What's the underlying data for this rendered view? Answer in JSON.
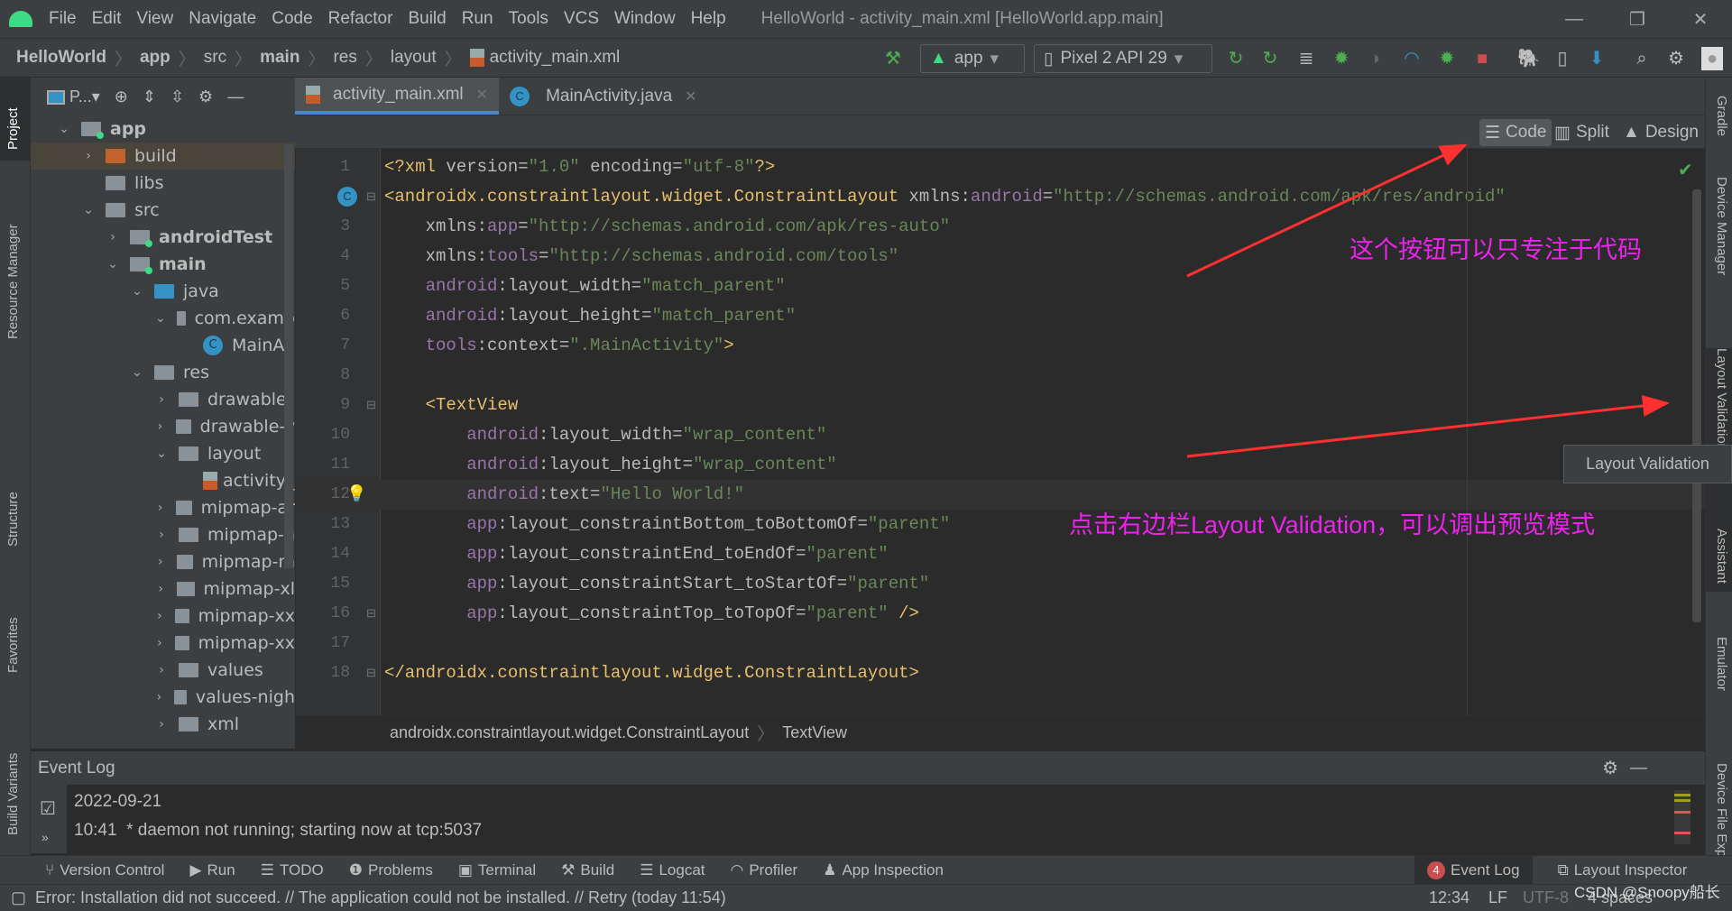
{
  "window": {
    "title": "HelloWorld - activity_main.xml [HelloWorld.app.main]",
    "menu": [
      "File",
      "Edit",
      "View",
      "Navigate",
      "Code",
      "Refactor",
      "Build",
      "Run",
      "Tools",
      "VCS",
      "Window",
      "Help"
    ]
  },
  "breadcrumb": [
    "HelloWorld",
    "app",
    "src",
    "main",
    "res",
    "layout",
    "activity_main.xml"
  ],
  "toolbar": {
    "run_config": "app",
    "device": "Pixel 2 API 29"
  },
  "left_strip": [
    "Project",
    "Resource Manager",
    "Structure",
    "Favorites",
    "Build Variants"
  ],
  "right_strip": [
    "Gradle",
    "Device Manager",
    "Layout Validation",
    "Assistant",
    "Emulator",
    "Device File Explorer"
  ],
  "project": {
    "view_label": "P...",
    "tree": [
      {
        "label": "app",
        "depth": 0,
        "open": "v",
        "icon": "module",
        "bold": true
      },
      {
        "label": "build",
        "depth": 1,
        "open": ">",
        "icon": "orange",
        "selected": true
      },
      {
        "label": "libs",
        "depth": 1,
        "open": "",
        "icon": "folder"
      },
      {
        "label": "src",
        "depth": 1,
        "open": "v",
        "icon": "folder"
      },
      {
        "label": "androidTest",
        "depth": 2,
        "open": ">",
        "icon": "module",
        "bold": true
      },
      {
        "label": "main",
        "depth": 2,
        "open": "v",
        "icon": "module",
        "bold": true
      },
      {
        "label": "java",
        "depth": 3,
        "open": "v",
        "icon": "blue"
      },
      {
        "label": "com.examp",
        "depth": 4,
        "open": "v",
        "icon": "package"
      },
      {
        "label": "MainAc",
        "depth": 5,
        "open": "",
        "icon": "class"
      },
      {
        "label": "res",
        "depth": 3,
        "open": "v",
        "icon": "res"
      },
      {
        "label": "drawable",
        "depth": 4,
        "open": ">",
        "icon": "folder"
      },
      {
        "label": "drawable-v",
        "depth": 4,
        "open": ">",
        "icon": "folder"
      },
      {
        "label": "layout",
        "depth": 4,
        "open": "v",
        "icon": "folder"
      },
      {
        "label": "activity_",
        "depth": 5,
        "open": "",
        "icon": "xml"
      },
      {
        "label": "mipmap-ar",
        "depth": 4,
        "open": ">",
        "icon": "folder"
      },
      {
        "label": "mipmap-h",
        "depth": 4,
        "open": ">",
        "icon": "folder"
      },
      {
        "label": "mipmap-m",
        "depth": 4,
        "open": ">",
        "icon": "folder"
      },
      {
        "label": "mipmap-xl",
        "depth": 4,
        "open": ">",
        "icon": "folder"
      },
      {
        "label": "mipmap-xx",
        "depth": 4,
        "open": ">",
        "icon": "folder"
      },
      {
        "label": "mipmap-xx",
        "depth": 4,
        "open": ">",
        "icon": "folder"
      },
      {
        "label": "values",
        "depth": 4,
        "open": ">",
        "icon": "folder"
      },
      {
        "label": "values-nigh",
        "depth": 4,
        "open": ">",
        "icon": "folder"
      },
      {
        "label": "xml",
        "depth": 4,
        "open": ">",
        "icon": "folder"
      }
    ]
  },
  "tabs": [
    {
      "label": "activity_main.xml",
      "active": true,
      "icon": "xml"
    },
    {
      "label": "MainActivity.java",
      "active": false,
      "icon": "class"
    }
  ],
  "editor_modes": [
    "Code",
    "Split",
    "Design"
  ],
  "active_mode": "Code",
  "current_line": 12,
  "code": [
    [
      [
        "<?xml ",
        "tag"
      ],
      [
        "version",
        "attr"
      ],
      [
        "=",
        "attr"
      ],
      [
        "\"1.0\"",
        "val"
      ],
      [
        " encoding",
        "attr"
      ],
      [
        "=",
        "attr"
      ],
      [
        "\"utf-8\"",
        "val"
      ],
      [
        "?>",
        "tag"
      ]
    ],
    [
      [
        "<androidx.constraintlayout.widget.ConstraintLayout ",
        "tag"
      ],
      [
        "xmlns:",
        "attr"
      ],
      [
        "android",
        "ns"
      ],
      [
        "=",
        "attr"
      ],
      [
        "\"http://schemas.android.com/apk/res/android\"",
        "val"
      ]
    ],
    [
      [
        "    xmlns:",
        "attr"
      ],
      [
        "app",
        "ns"
      ],
      [
        "=",
        "attr"
      ],
      [
        "\"http://schemas.android.com/apk/res-auto\"",
        "val"
      ]
    ],
    [
      [
        "    xmlns:",
        "attr"
      ],
      [
        "tools",
        "ns"
      ],
      [
        "=",
        "attr"
      ],
      [
        "\"http://schemas.android.com/tools\"",
        "val"
      ]
    ],
    [
      [
        "    android",
        "ns"
      ],
      [
        ":layout_width",
        "attr"
      ],
      [
        "=",
        "attr"
      ],
      [
        "\"match_parent\"",
        "val"
      ]
    ],
    [
      [
        "    android",
        "ns"
      ],
      [
        ":layout_height",
        "attr"
      ],
      [
        "=",
        "attr"
      ],
      [
        "\"match_parent\"",
        "val"
      ]
    ],
    [
      [
        "    tools",
        "ns"
      ],
      [
        ":context",
        "attr"
      ],
      [
        "=",
        "attr"
      ],
      [
        "\".MainActivity\"",
        "val"
      ],
      [
        ">",
        "tag"
      ]
    ],
    [
      [
        "",
        "txt"
      ]
    ],
    [
      [
        "    <TextView",
        "tag"
      ]
    ],
    [
      [
        "        android",
        "ns"
      ],
      [
        ":layout_width",
        "attr"
      ],
      [
        "=",
        "attr"
      ],
      [
        "\"wrap_content\"",
        "val"
      ]
    ],
    [
      [
        "        android",
        "ns"
      ],
      [
        ":layout_height",
        "attr"
      ],
      [
        "=",
        "attr"
      ],
      [
        "\"wrap_content\"",
        "val"
      ]
    ],
    [
      [
        "        android",
        "ns"
      ],
      [
        ":text",
        "attr"
      ],
      [
        "=",
        "attr"
      ],
      [
        "\"Hello World!\"",
        "val"
      ]
    ],
    [
      [
        "        app",
        "ns"
      ],
      [
        ":layout_constraintBottom_toBottomOf",
        "attr"
      ],
      [
        "=",
        "attr"
      ],
      [
        "\"parent\"",
        "val"
      ]
    ],
    [
      [
        "        app",
        "ns"
      ],
      [
        ":layout_constraintEnd_toEndOf",
        "attr"
      ],
      [
        "=",
        "attr"
      ],
      [
        "\"parent\"",
        "val"
      ]
    ],
    [
      [
        "        app",
        "ns"
      ],
      [
        ":layout_constraintStart_toStartOf",
        "attr"
      ],
      [
        "=",
        "attr"
      ],
      [
        "\"parent\"",
        "val"
      ]
    ],
    [
      [
        "        app",
        "ns"
      ],
      [
        ":layout_constraintTop_toTopOf",
        "attr"
      ],
      [
        "=",
        "attr"
      ],
      [
        "\"parent\"",
        "val"
      ],
      [
        " />",
        "tag"
      ]
    ],
    [
      [
        "",
        "txt"
      ]
    ],
    [
      [
        "</androidx.constraintlayout.widget.ConstraintLayout>",
        "tag"
      ]
    ]
  ],
  "editor_breadcrumb": [
    "androidx.constraintlayout.widget.ConstraintLayout",
    "TextView"
  ],
  "event_log": {
    "title": "Event Log",
    "date": "2022-09-21",
    "time": "10:41",
    "message": "* daemon not running; starting now at tcp:5037"
  },
  "bottom_tools": [
    "Version Control",
    "Run",
    "TODO",
    "Problems",
    "Terminal",
    "Build",
    "Logcat",
    "Profiler",
    "App Inspection"
  ],
  "bottom_right_tools": [
    {
      "label": "Event Log",
      "badge": "4"
    },
    {
      "label": "Layout Inspector"
    }
  ],
  "status": {
    "message": "Error: Installation did not succeed. // The application could not be installed. // Retry (today 11:54)",
    "position": "12:34",
    "line_sep": "LF",
    "encoding": "UTF-8",
    "indent": "4 spaces",
    "watermark": "CSDN @Snoopy船长"
  },
  "tooltip": "Layout Validation",
  "annotations": {
    "note1": "这个按钮可以只专注于代码",
    "note2": "点击右边栏Layout Validation，可以调出预览模式",
    "color": "#ee22ee",
    "arrow_color": "#ff3030"
  }
}
